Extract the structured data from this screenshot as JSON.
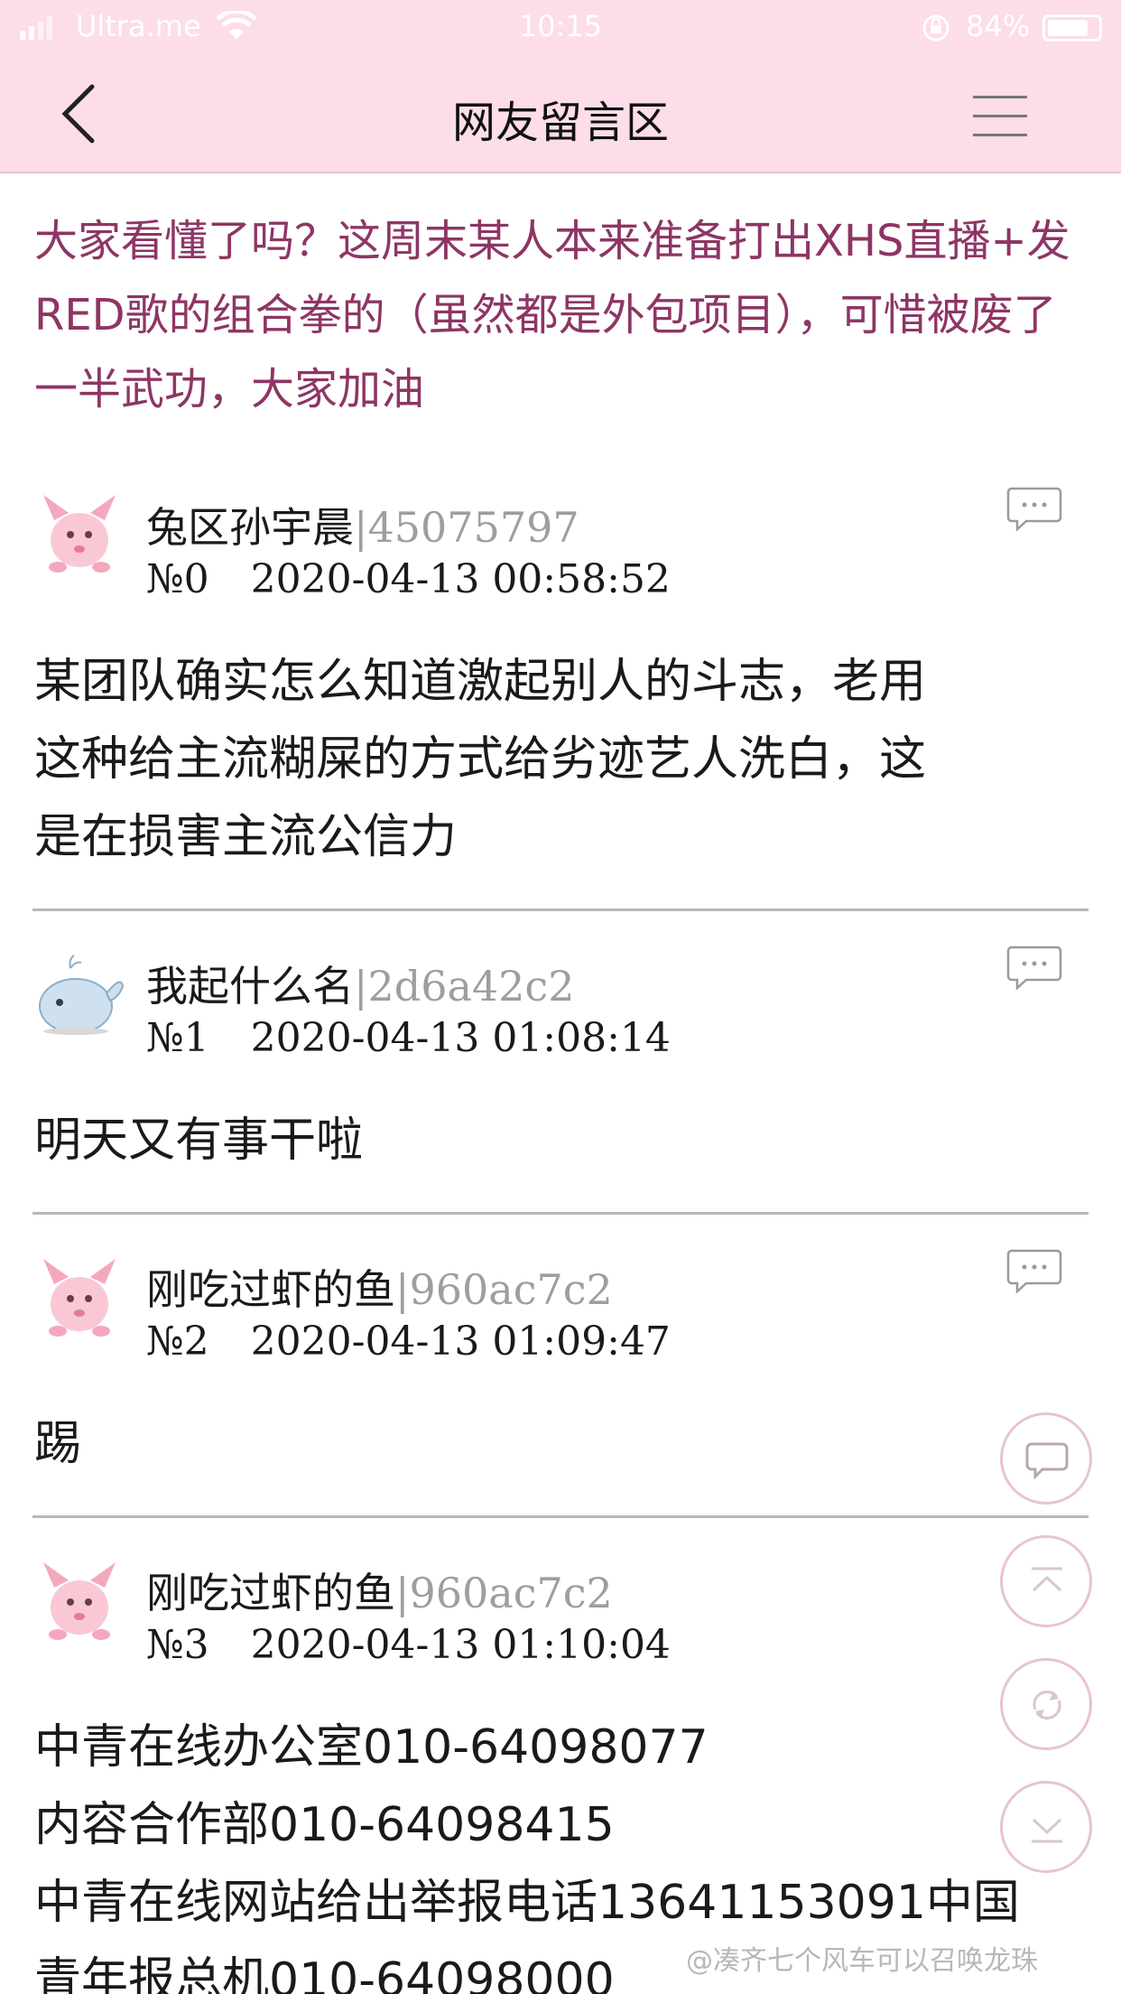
{
  "status_bar": {
    "carrier": "Ultra.me",
    "time": "10:15",
    "battery": "84%"
  },
  "nav": {
    "title": "网友留言区"
  },
  "main_post": "大家看懂了吗？这周末某人本来准备打出XHS直播+发RED歌的组合拳的（虽然都是外包项目），可惜被废了一半武功，大家加油",
  "comments": [
    {
      "username": "兔区孙宇晨",
      "uid": "|45075797",
      "number": "№0",
      "datetime": "2020-04-13 00:58:52",
      "body": [
        "某团队确实怎么知道激起别人的斗志，老用",
        "这种给主流糊屎的方式给劣迹艺人洗白，这",
        "是在损害主流公信力"
      ]
    },
    {
      "username": "我起什么名",
      "uid": "|2d6a42c2",
      "number": "№1",
      "datetime": "2020-04-13 01:08:14",
      "body": [
        "明天又有事干啦"
      ]
    },
    {
      "username": "刚吃过虾的鱼",
      "uid": "|960ac7c2",
      "number": "№2",
      "datetime": "2020-04-13 01:09:47",
      "body": [
        "踢"
      ]
    },
    {
      "username": "刚吃过虾的鱼",
      "uid": "|960ac7c2",
      "number": "№3",
      "datetime": "2020-04-13 01:10:04",
      "body": [
        "中青在线办公室010-64098077",
        "内容合作部010-64098415",
        "中青在线网站给出举报电话13641153091中国",
        "青年报总机010-64098000"
      ]
    }
  ],
  "watermark": "@凑齐七个风车可以召唤龙珠",
  "colors": {
    "header_bg": "#fcdde9",
    "post_text": "#8e3565",
    "uid_text": "#9e9e9e",
    "divider": "#b8b8b8"
  }
}
